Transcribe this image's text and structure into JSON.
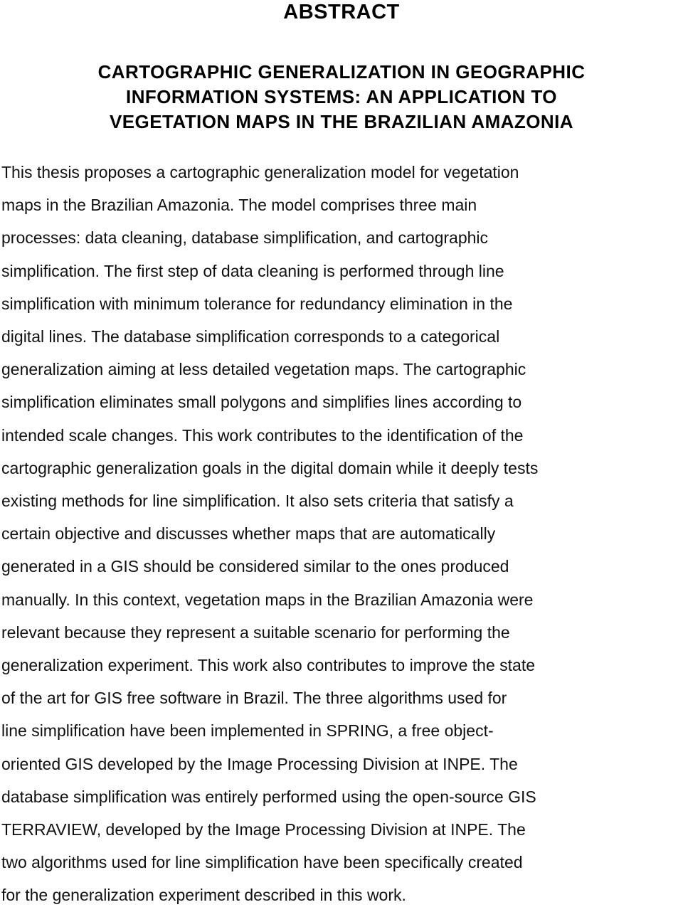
{
  "document": {
    "heading": "ABSTRACT",
    "title_lines": [
      "CARTOGRAPHIC GENERALIZATION IN GEOGRAPHIC",
      "INFORMATION SYSTEMS:  AN APPLICATION TO",
      "VEGETATION MAPS IN THE BRAZILIAN AMAZONIA"
    ],
    "title_full": "CARTOGRAPHIC GENERALIZATION IN GEOGRAPHIC INFORMATION SYSTEMS: AN APPLICATION TO VEGETATION MAPS IN THE BRAZILIAN AMAZONIA",
    "abstract_text": "This thesis proposes a cartographic generalization model for vegetation maps in the Brazilian Amazonia. The model comprises three main processes: data cleaning, database simplification, and cartographic simplification. The first step of data cleaning is performed through line simplification with minimum tolerance for redundancy elimination in the digital lines. The database simplification corresponds to a categorical generalization aiming at less detailed vegetation maps. The cartographic simplification eliminates small polygons and simplifies lines according to intended scale changes. This work contributes to the identification of the cartographic generalization goals in the digital domain while it deeply tests existing methods for line simplification. It also sets criteria that satisfy a certain objective and discusses whether maps that are automatically generated in a GIS should be considered similar to the ones produced manually. In this context, vegetation maps in the Brazilian Amazonia were relevant because they represent a suitable scenario for performing the generalization experiment. This work also contributes to improve the state of the art for GIS free software in Brazil. The three algorithms used for line simplification have been implemented in SPRING, a free object-oriented GIS developed by the Image Processing Division at INPE. The database simplification was entirely performed using the open-source GIS TERRAVIEW, developed by the Image Processing Division at INPE. The two algorithms used for line simplification have been specifically created for the generalization experiment described in this work.",
    "body_lines": [
      "This thesis proposes a cartographic generalization model for vegetation",
      "maps in the Brazilian Amazonia. The model comprises three main",
      "processes: data cleaning, database simplification, and cartographic",
      "simplification. The first step of data cleaning is performed through line",
      "simplification with minimum tolerance for redundancy elimination in the",
      "digital lines. The database simplification corresponds to a categorical",
      "generalization aiming at less detailed vegetation maps. The cartographic",
      "simplification eliminates small polygons and simplifies lines according to",
      "intended scale changes. This work contributes to the identification of the",
      "cartographic generalization goals in the digital domain while it deeply tests",
      "existing methods for line simplification. It also sets criteria that satisfy a",
      "certain objective and discusses whether maps that are automatically",
      "generated in a GIS should be considered similar to the ones produced",
      "manually. In this context, vegetation maps in the Brazilian Amazonia were",
      "relevant because they represent a suitable scenario for performing the",
      "generalization experiment. This work also contributes to improve the state",
      "of the art for GIS free software in Brazil. The three algorithms used for",
      "line simplification have been implemented in SPRING, a free object-",
      "oriented GIS developed by the Image Processing Division at INPE. The",
      "database simplification was entirely performed using the open-source GIS",
      "TERRAVIEW, developed by the Image Processing Division at INPE. The",
      "two algorithms used for line simplification have been specifically created",
      "for the generalization experiment described in this work."
    ],
    "colors": {
      "page_background": "#ffffff",
      "text": "#101010",
      "heading_text": "#000000"
    }
  }
}
